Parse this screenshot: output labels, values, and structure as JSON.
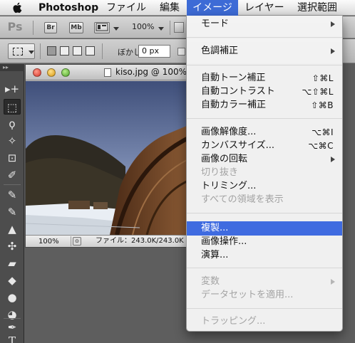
{
  "menubar": {
    "apple": "",
    "app_name": "Photoshop",
    "items": [
      "ファイル",
      "編集",
      "イメージ",
      "レイヤー",
      "選択範囲"
    ]
  },
  "appbar": {
    "logo": "Ps",
    "bridge": "Br",
    "minibridge": "Mb",
    "zoom": "100%"
  },
  "options": {
    "feather_label": "ぼかし：",
    "feather_value": "0 px"
  },
  "toolpanel": {
    "header": "▸▸",
    "tools": [
      "▸+",
      "⬚",
      "ϙ",
      "✧",
      "⊡",
      "✐",
      "✎",
      "✎",
      "▲",
      "✣",
      "▰",
      "◆",
      "●",
      "◕",
      "✒",
      "T"
    ]
  },
  "document": {
    "title": "kiso.jpg @ 100%",
    "zoom": "100%",
    "file_info": "ファイル：243.0K/243.0K"
  },
  "menu": {
    "items": [
      {
        "label": "モード",
        "shortcut": "",
        "submenu": true,
        "disabled": false,
        "highlighted": false
      },
      {
        "label": "色調補正",
        "shortcut": "",
        "submenu": true,
        "disabled": false,
        "highlighted": false
      },
      {
        "label": "自動トーン補正",
        "shortcut": "⇧⌘L",
        "submenu": false,
        "disabled": false,
        "highlighted": false
      },
      {
        "label": "自動コントラスト",
        "shortcut": "⌥⇧⌘L",
        "submenu": false,
        "disabled": false,
        "highlighted": false
      },
      {
        "label": "自動カラー補正",
        "shortcut": "⇧⌘B",
        "submenu": false,
        "disabled": false,
        "highlighted": false
      },
      {
        "label": "画像解像度...",
        "shortcut": "⌥⌘I",
        "submenu": false,
        "disabled": false,
        "highlighted": false
      },
      {
        "label": "カンバスサイズ...",
        "shortcut": "⌥⌘C",
        "submenu": false,
        "disabled": false,
        "highlighted": false
      },
      {
        "label": "画像の回転",
        "shortcut": "",
        "submenu": true,
        "disabled": false,
        "highlighted": false
      },
      {
        "label": "切り抜き",
        "shortcut": "",
        "submenu": false,
        "disabled": true,
        "highlighted": false
      },
      {
        "label": "トリミング...",
        "shortcut": "",
        "submenu": false,
        "disabled": false,
        "highlighted": false
      },
      {
        "label": "すべての領域を表示",
        "shortcut": "",
        "submenu": false,
        "disabled": true,
        "highlighted": false
      },
      {
        "label": "複製...",
        "shortcut": "",
        "submenu": false,
        "disabled": false,
        "highlighted": true
      },
      {
        "label": "画像操作...",
        "shortcut": "",
        "submenu": false,
        "disabled": false,
        "highlighted": false
      },
      {
        "label": "演算...",
        "shortcut": "",
        "submenu": false,
        "disabled": false,
        "highlighted": false
      },
      {
        "label": "変数",
        "shortcut": "",
        "submenu": true,
        "disabled": true,
        "highlighted": false
      },
      {
        "label": "データセットを適用...",
        "shortcut": "",
        "submenu": false,
        "disabled": true,
        "highlighted": false
      },
      {
        "label": "トラッピング...",
        "shortcut": "",
        "submenu": false,
        "disabled": true,
        "highlighted": false
      }
    ]
  },
  "colors": {
    "menu_highlight": "#3f6be0",
    "menubar_selected": "#3d6bd6",
    "disabled_text": "#a3a3a3"
  }
}
